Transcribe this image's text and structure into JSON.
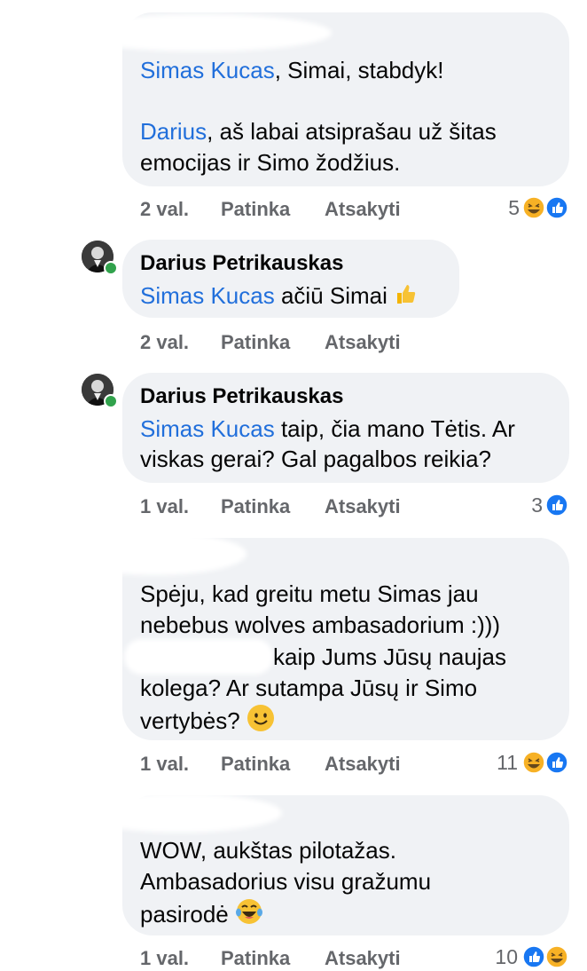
{
  "comments": [
    {
      "lines": [
        {
          "mention": "Simas Kucas",
          "text": ", Simai, stabdyk!"
        },
        {
          "mention": "Darius",
          "text": ", aš labai atsiprašau už šitas"
        },
        {
          "mention": "",
          "text": "emocijas ir Simo žodžius."
        }
      ],
      "meta": {
        "time": "2 val.",
        "like": "Patinka",
        "reply": "Atsakyti"
      },
      "reaction_count": "5",
      "reactions": [
        "haha-icon",
        "like-icon"
      ]
    },
    {
      "author": "Darius Petrikauskas",
      "lines": [
        {
          "mention": "Simas Kucas",
          "text": " ačiū Simai"
        }
      ],
      "meta": {
        "time": "2 val.",
        "like": "Patinka",
        "reply": "Atsakyti"
      }
    },
    {
      "author": "Darius Petrikauskas",
      "lines": [
        {
          "mention": "Simas Kucas",
          "text": " taip, čia mano Tėtis. Ar"
        },
        {
          "mention": "",
          "text": "viskas gerai? Gal pagalbos reikia?"
        }
      ],
      "meta": {
        "time": "1 val.",
        "like": "Patinka",
        "reply": "Atsakyti"
      },
      "reaction_count": "3",
      "reactions": [
        "like-icon"
      ]
    },
    {
      "lines": [
        {
          "mention": "",
          "text": "Spėju, kad greitu metu Simas jau"
        },
        {
          "mention": "",
          "text": "nebebus wolves ambasadorium :)))"
        },
        {
          "mention": "",
          "text": "kaip Jums Jūsų naujas"
        },
        {
          "mention": "",
          "text": "kolega? Ar sutampa Jūsų ir Simo"
        },
        {
          "mention": "",
          "text": "vertybės?"
        }
      ],
      "meta": {
        "time": "1 val.",
        "like": "Patinka",
        "reply": "Atsakyti"
      },
      "reaction_count": "11",
      "reactions": [
        "haha-icon",
        "like-icon"
      ]
    },
    {
      "lines": [
        {
          "mention": "",
          "text": "WOW, aukštas pilotažas."
        },
        {
          "mention": "",
          "text": "Ambasadorius visu gražumu"
        },
        {
          "mention": "",
          "text": "pasirodė"
        }
      ],
      "meta": {
        "time": "1 val.",
        "like": "Patinka",
        "reply": "Atsakyti"
      },
      "reaction_count": "10",
      "reactions": [
        "like-icon",
        "haha-icon"
      ]
    }
  ],
  "colors": {
    "bubble": "#f0f2f5",
    "mention": "#216fdb",
    "meta": "#65676b",
    "like": "#1877f2",
    "haha": "#f7b125",
    "online": "#31a24c"
  }
}
